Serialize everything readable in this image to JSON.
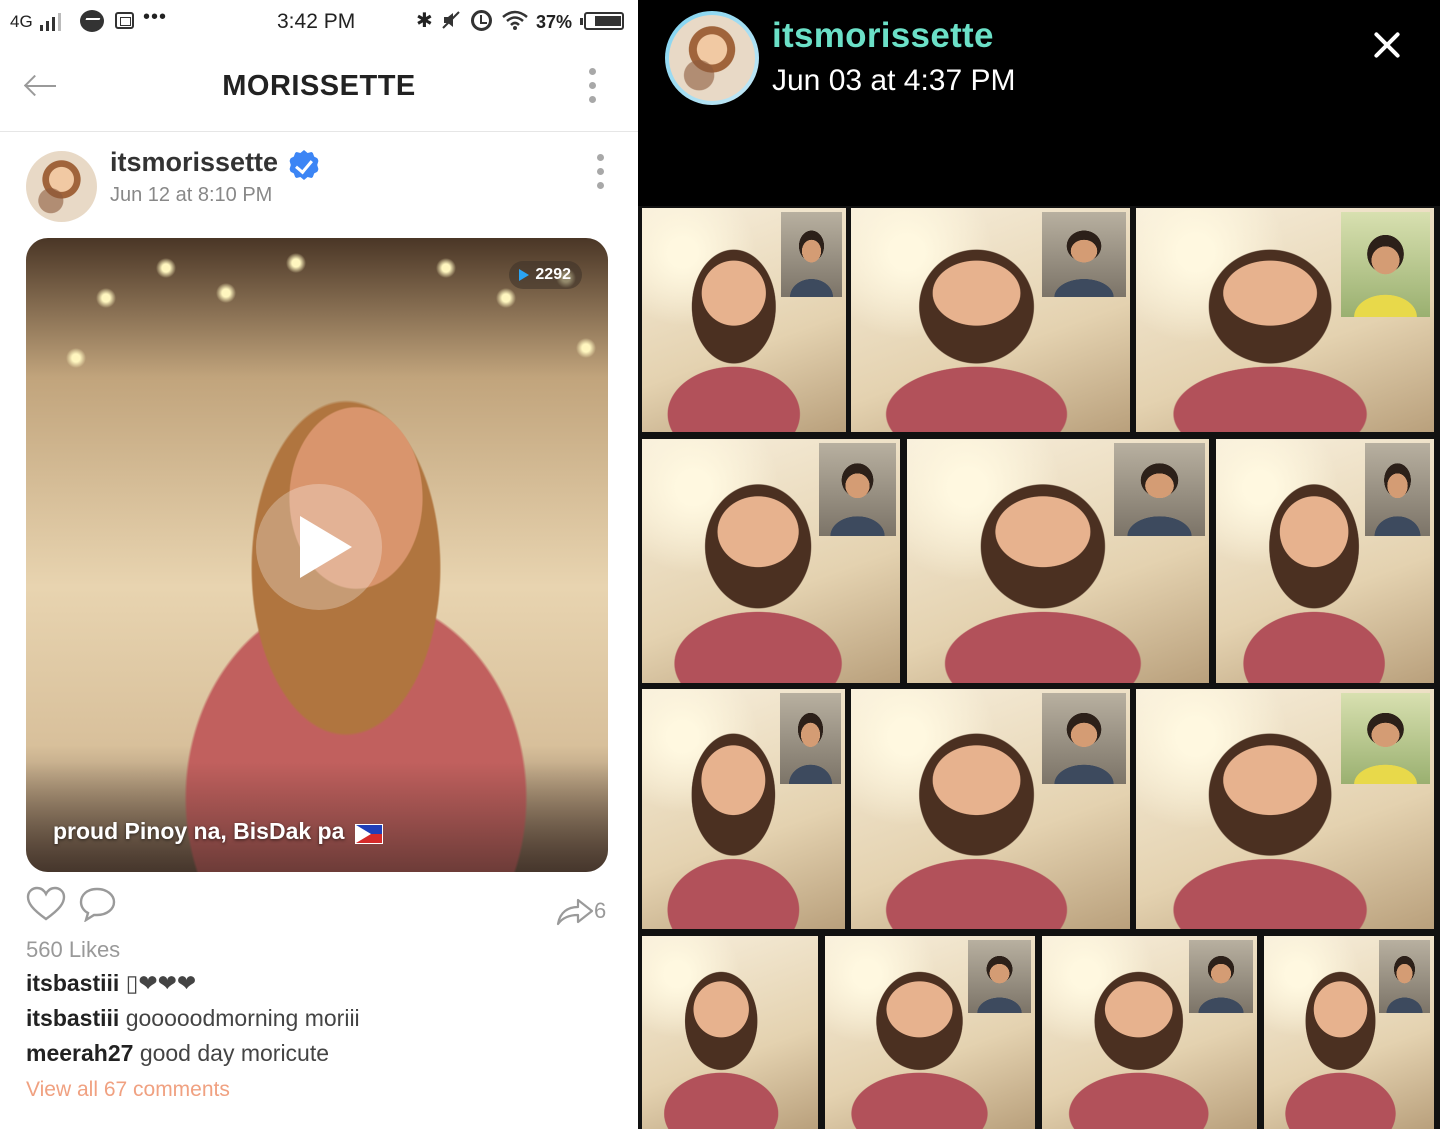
{
  "status_bar": {
    "network": "4G",
    "time": "3:42 PM",
    "battery_percent": "37%",
    "icons": [
      "signal-icon",
      "messenger-icon",
      "mail-icon",
      "more-icon",
      "bluetooth-icon",
      "mute-icon",
      "alarm-icon",
      "wifi-icon",
      "battery-icon"
    ]
  },
  "app_bar": {
    "title": "MORISSETTE",
    "back_icon": "arrow-left-icon",
    "menu_icon": "more-vertical-icon"
  },
  "post": {
    "username": "itsmorissette",
    "verified": true,
    "date": "Jun 12 at 8:10 PM",
    "view_count": "2292",
    "caption": "proud Pinoy na, BisDak pa",
    "share_count": "6",
    "likes": "560 Likes",
    "comments": [
      {
        "user": "itsbastiii",
        "text": "▯❤❤❤"
      },
      {
        "user": "itsbastiii",
        "text": "gooooodmorning moriii"
      },
      {
        "user": "meerah27",
        "text": "good day moricute"
      }
    ],
    "view_all": "View all 67 comments"
  },
  "story": {
    "username": "itsmorissette",
    "date": "Jun 03 at 4:37 PM",
    "username_color": "#6be0c7"
  },
  "colors": {
    "accent_link": "#f0a181",
    "verified_blue": "#3c85f5",
    "views_play": "#2aa4f4"
  }
}
